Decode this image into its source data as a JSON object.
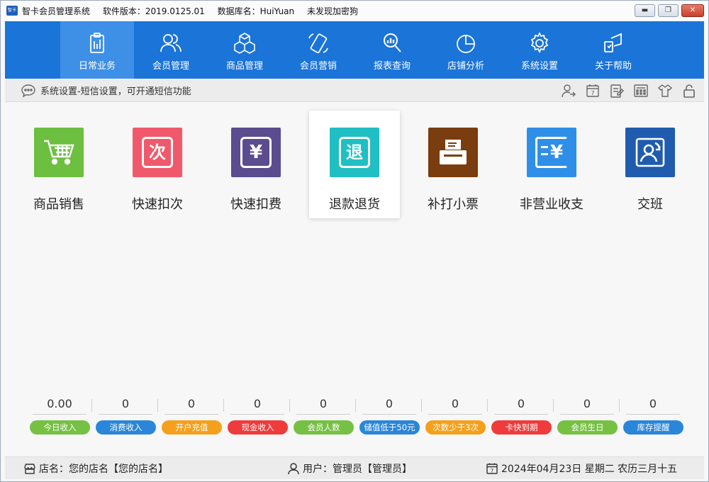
{
  "window": {
    "app_icon_text": "智卡",
    "app_name": "智卡会员管理系统",
    "version": "软件版本：2019.0125.01",
    "database": "数据库名：HuiYuan",
    "dongle": "未发现加密狗",
    "btn_minimize": "▬",
    "btn_maximize": "❐",
    "btn_close": "✕"
  },
  "nav": [
    {
      "label": "日常业务",
      "icon": "clipboard-icon",
      "active": true
    },
    {
      "label": "会员管理",
      "icon": "users-icon"
    },
    {
      "label": "商品管理",
      "icon": "cubes-icon"
    },
    {
      "label": "会员营销",
      "icon": "phone-icon"
    },
    {
      "label": "报表查询",
      "icon": "report-search-icon"
    },
    {
      "label": "店铺分析",
      "icon": "pie-chart-icon"
    },
    {
      "label": "系统设置",
      "icon": "gear-icon"
    },
    {
      "label": "关于帮助",
      "icon": "help-icon"
    }
  ],
  "toolbar": {
    "message": "系统设置-短信设置，可开通短信功能",
    "icons": [
      "user-switch-icon",
      "calendar-icon",
      "notepad-icon",
      "calculator-icon",
      "shirt-icon",
      "lock-icon"
    ],
    "calendar_day": "7"
  },
  "tiles": [
    {
      "label": "商品销售",
      "color": "#6cbf3f",
      "icon": "cart-icon"
    },
    {
      "label": "快速扣次",
      "color": "#f0596b",
      "glyph": "次",
      "icon": "deduct-times-icon"
    },
    {
      "label": "快速扣费",
      "color": "#5a4c8e",
      "glyph": "¥",
      "icon": "deduct-fee-icon"
    },
    {
      "label": "退款退货",
      "color": "#1fbfc4",
      "glyph": "退",
      "icon": "refund-icon",
      "active": true
    },
    {
      "label": "补打小票",
      "color": "#7a3d0f",
      "icon": "printer-icon"
    },
    {
      "label": "非营业收支",
      "color": "#2f8fe8",
      "glyph": "¥",
      "icon": "expense-icon"
    },
    {
      "label": "交班",
      "color": "#1f5cae",
      "icon": "shift-change-icon"
    }
  ],
  "stats": [
    {
      "value": "0.00",
      "label": "今日收入",
      "color": "#76c043"
    },
    {
      "value": "0",
      "label": "消费收入",
      "color": "#2a86d8"
    },
    {
      "value": "0",
      "label": "开户充值",
      "color": "#f5a01d"
    },
    {
      "value": "0",
      "label": "现金收入",
      "color": "#ef3b3b"
    },
    {
      "value": "0",
      "label": "会员人数",
      "color": "#76c043"
    },
    {
      "value": "0",
      "label": "储值低于50元",
      "color": "#2a86d8"
    },
    {
      "value": "0",
      "label": "次数少于3次",
      "color": "#f5a01d"
    },
    {
      "value": "0",
      "label": "卡快到期",
      "color": "#ef3b3b"
    },
    {
      "value": "0",
      "label": "会员生日",
      "color": "#76c043"
    },
    {
      "value": "0",
      "label": "库存提醒",
      "color": "#2a86d8"
    }
  ],
  "status": {
    "store": "店名：您的店名【您的店名】",
    "user": "用户：管理员【管理员】",
    "date": "2024年04月23日 星期二 农历三月十五",
    "calendar_day": "7"
  }
}
